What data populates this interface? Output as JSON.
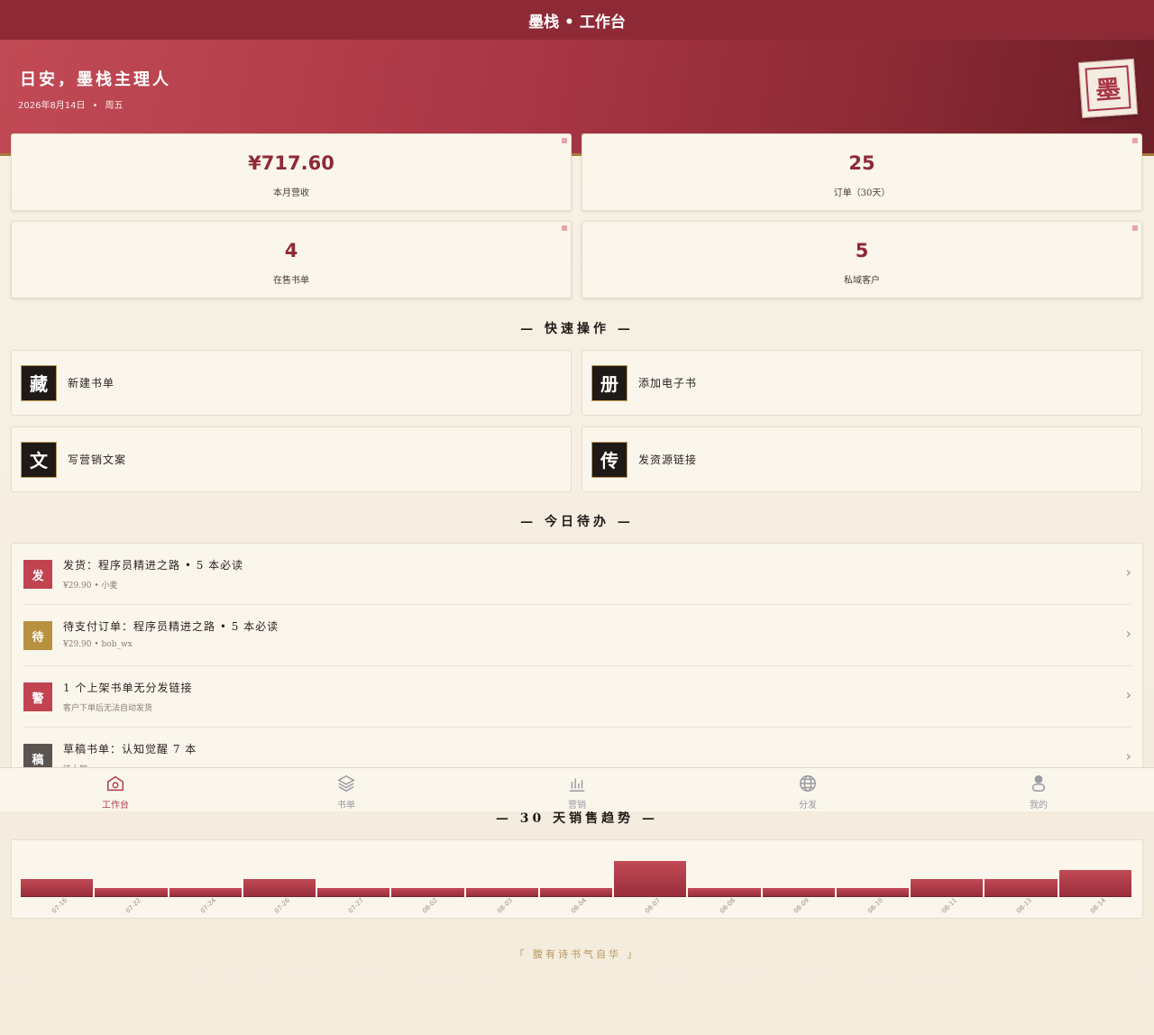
{
  "header": {
    "title": "墨栈 • 工作台"
  },
  "hero": {
    "greeting": "日安，墨栈主理人",
    "date": "2026年8月14日",
    "weekday": "周五",
    "seal_char": "墨"
  },
  "stats": [
    {
      "value": "¥717.60",
      "label": "本月营收"
    },
    {
      "value": "25",
      "label": "订单（30天）"
    },
    {
      "value": "4",
      "label": "在售书单"
    },
    {
      "value": "5",
      "label": "私域客户"
    }
  ],
  "quick_actions": {
    "title": "— 快速操作 —",
    "items": [
      {
        "icon": "藏",
        "label": "新建书单"
      },
      {
        "icon": "册",
        "label": "添加电子书"
      },
      {
        "icon": "文",
        "label": "写营销文案"
      },
      {
        "icon": "传",
        "label": "发资源链接"
      }
    ]
  },
  "todo": {
    "title": "— 今日待办 —",
    "items": [
      {
        "icon": "发",
        "color": "#c0434f",
        "title": "发货：程序员精进之路 • 5 本必读",
        "sub": "¥29.90 • 小麦"
      },
      {
        "icon": "待",
        "color": "#b8913e",
        "title": "待支付订单：程序员精进之路 • 5 本必读",
        "sub": "¥29.90 • bob_wx"
      },
      {
        "icon": "警",
        "color": "#c0434f",
        "title": "1 个上架书单无分发链接",
        "sub": "客户下单后无法自动发货"
      },
      {
        "icon": "稿",
        "color": "#5b5450",
        "title": "草稿书单：认知觉醒 7 本",
        "sub": "待上架"
      }
    ],
    "arrow": "›"
  },
  "tabs": [
    {
      "label": "工作台",
      "icon": "home-icon",
      "active": true
    },
    {
      "label": "书单",
      "icon": "layers-icon",
      "active": false
    },
    {
      "label": "营销",
      "icon": "bar-chart-icon",
      "active": false
    },
    {
      "label": "分发",
      "icon": "globe-icon",
      "active": false
    },
    {
      "label": "我的",
      "icon": "user-icon",
      "active": false
    }
  ],
  "trend_title": "— 30 天销售趋势 —",
  "chart_data": {
    "type": "bar",
    "categories": [
      "07-16",
      "07-22",
      "07-24",
      "07-26",
      "07-27",
      "08-02",
      "08-03",
      "08-04",
      "08-07",
      "08-08",
      "08-09",
      "08-10",
      "08-11",
      "08-13",
      "08-14"
    ],
    "values": [
      2,
      1,
      1,
      2,
      1,
      1,
      1,
      1,
      4,
      1,
      1,
      1,
      2,
      2,
      3
    ],
    "ylim": [
      0,
      4
    ],
    "bar_color": "#b23a48"
  },
  "footer_quote": "「 腹有诗书气自华 」",
  "colors": {
    "primary": "#8e2a36",
    "accent": "#b23a48",
    "gold": "#c49a55"
  }
}
